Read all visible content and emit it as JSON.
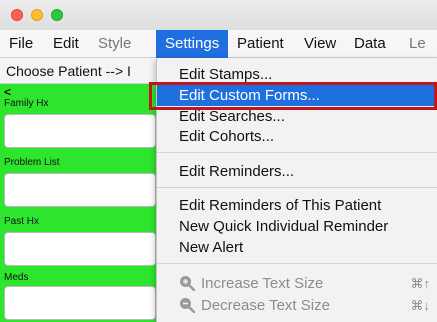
{
  "menubar": {
    "items": [
      {
        "label": "File"
      },
      {
        "label": "Edit"
      },
      {
        "label": "Style"
      },
      {
        "label": "Settings"
      },
      {
        "label": "Patient"
      },
      {
        "label": "View"
      },
      {
        "label": "Data"
      },
      {
        "label": "Le"
      }
    ]
  },
  "patient_bar": {
    "label": "Choose Patient --> I"
  },
  "side_panel": {
    "back": "<",
    "sections": [
      {
        "label": "Family Hx"
      },
      {
        "label": "Problem List"
      },
      {
        "label": "Past Hx"
      },
      {
        "label": "Meds"
      }
    ],
    "color": "#2ee52e"
  },
  "settings_menu": {
    "items": [
      {
        "label": "Edit Stamps..."
      },
      {
        "label": "Edit Custom Forms..."
      },
      {
        "label": "Edit Searches..."
      },
      {
        "label": "Edit Cohorts..."
      },
      {
        "label": "Edit Reminders..."
      },
      {
        "label": "Edit Reminders of This Patient"
      },
      {
        "label": "New Quick Individual Reminder"
      },
      {
        "label": "New Alert"
      },
      {
        "label": "Increase Text Size",
        "shortcut": "⌘↑",
        "icon": "zoom-in-icon"
      },
      {
        "label": "Decrease Text Size",
        "shortcut": "⌘↓",
        "icon": "zoom-out-icon"
      }
    ],
    "highlight_color": "#1f6fde",
    "callout_color": "#c0161c"
  }
}
